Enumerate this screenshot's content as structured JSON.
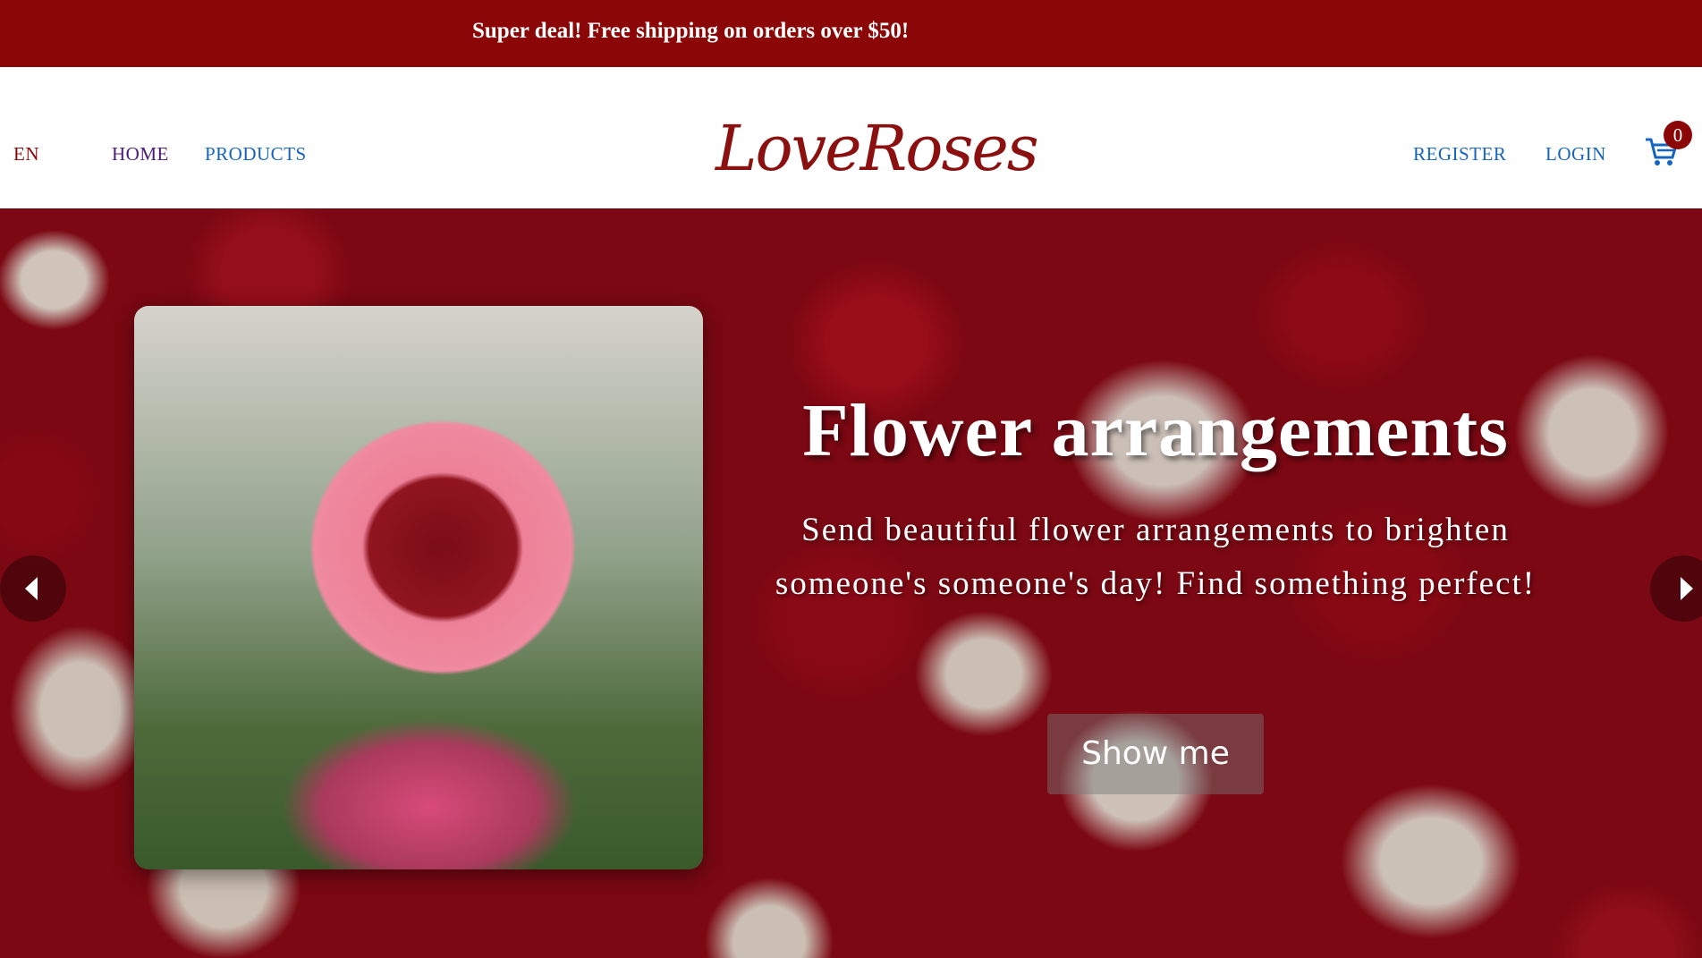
{
  "promo": {
    "text": "Super deal! Free shipping on orders over $50!"
  },
  "header": {
    "language": "EN",
    "nav": {
      "home": "HOME",
      "products": "PRODUCTS"
    },
    "logo": "LoveRoses",
    "auth": {
      "register": "REGISTER",
      "login": "LOGIN"
    },
    "cart": {
      "icon": "cart-icon",
      "count": "0"
    }
  },
  "hero": {
    "title": "Flower arrangements",
    "description": "Send beautiful flower arrangements to brighten someone's someone's day! Find something perfect!",
    "button": "Show me",
    "prev_icon": "chevron-left-icon",
    "next_icon": "chevron-right-icon"
  },
  "colors": {
    "brand": "#8b0707",
    "link": "#1565c0",
    "white": "#ffffff"
  }
}
